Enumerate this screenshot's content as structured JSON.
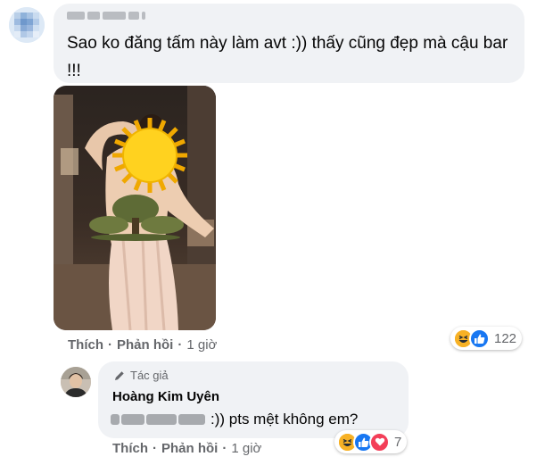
{
  "comment": {
    "text": "Sao ko đăng tấm này làm avt :)) thấy cũng đẹp mà cậu bar !!!",
    "actions": {
      "like": "Thích",
      "reply": "Phản hồi",
      "time": "1 giờ"
    },
    "reactions": {
      "icons": [
        "haha-icon",
        "like-icon"
      ],
      "count": "122"
    }
  },
  "reply": {
    "author_badge": "Tác giả",
    "author_name": "Hoàng Kim Uyên",
    "text_visible": ":)) pts mệt không em?",
    "actions": {
      "like": "Thích",
      "reply": "Phản hồi",
      "time": "1 giờ"
    },
    "reactions": {
      "icons": [
        "haha-icon",
        "like-icon",
        "love-icon"
      ],
      "count": "7"
    }
  },
  "colors": {
    "bubble": "#f0f2f5",
    "meta": "#65676b",
    "like_blue": "#1877f2",
    "love_red": "#f33e58",
    "haha_yellow": "#f7b125"
  }
}
